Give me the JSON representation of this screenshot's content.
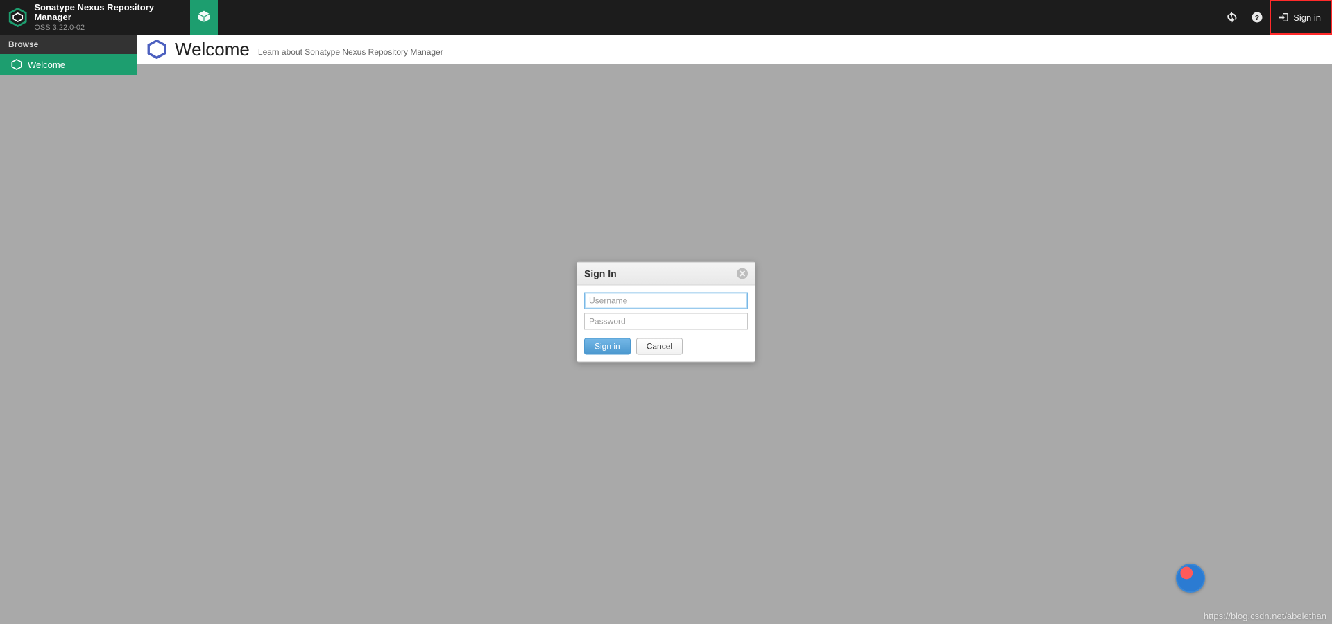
{
  "header": {
    "app_title": "Sonatype Nexus Repository Manager",
    "app_version": "OSS 3.22.0-02",
    "signin_label": "Sign in"
  },
  "sidebar": {
    "section_label": "Browse",
    "items": [
      {
        "label": "Welcome"
      }
    ]
  },
  "welcome": {
    "title": "Welcome",
    "subtitle": "Learn about Sonatype Nexus Repository Manager"
  },
  "dialog": {
    "title": "Sign In",
    "username_placeholder": "Username",
    "password_placeholder": "Password",
    "signin_label": "Sign in",
    "cancel_label": "Cancel"
  },
  "watermark": "https://blog.csdn.net/abelethan"
}
